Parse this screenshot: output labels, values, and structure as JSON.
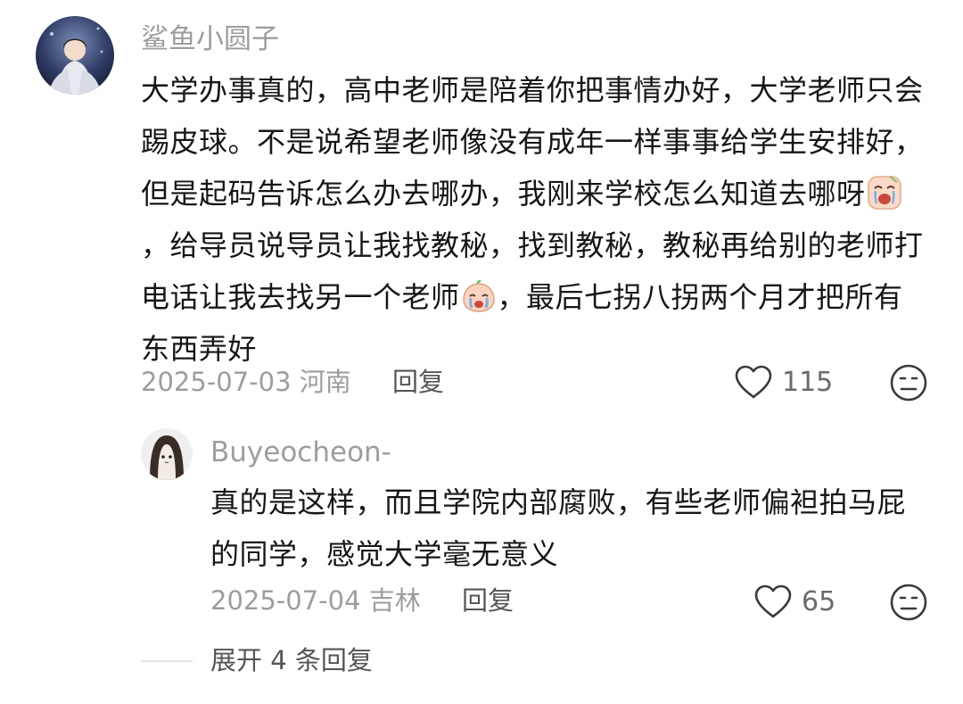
{
  "comment": {
    "username": "鲨鱼小圆子",
    "text_before_emoji1": "大学办事真的，高中老师是陪着你把事情办好，大学老师只会踢皮球。不是说希望老师像没有成年一样事事给学生安排好，但是起码告诉怎么办去哪办，我刚来学校怎么知道去哪呀",
    "text_between_emojis": "，给导员说导员让我找教秘，找到教秘，教秘再给别的老师打电话让我去找另一个老师",
    "text_after_emoji2": "，最后七拐八拐两个月才把所有东西弄好",
    "emoji1": "crying-face-emoji",
    "emoji2": "crying-face-emoji",
    "date": "2025-07-03",
    "location": "河南",
    "reply_label": "回复",
    "likes": "115"
  },
  "reply": {
    "username": "Buyeocheon-",
    "text": "真的是这样，而且学院内部腐败，有些老师偏袒拍马屁的同学，感觉大学毫无意义",
    "date": "2025-07-04",
    "location": "吉林",
    "reply_label": "回复",
    "likes": "65"
  },
  "expand_replies": "展开 4 条回复",
  "icons": {
    "like": "heart-outline-icon",
    "dislike": "neutral-face-icon"
  },
  "colors": {
    "text": "#161616",
    "meta": "#9d9d9d",
    "action": "#555555"
  }
}
